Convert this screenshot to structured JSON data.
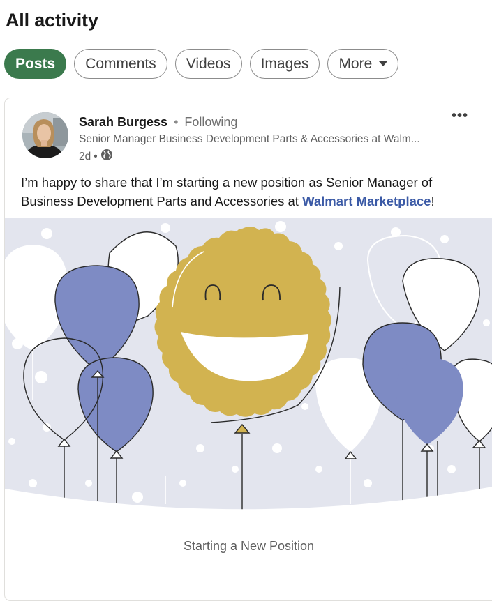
{
  "page": {
    "title": "All activity"
  },
  "filters": [
    {
      "label": "Posts",
      "active": true
    },
    {
      "label": "Comments",
      "active": false
    },
    {
      "label": "Videos",
      "active": false
    },
    {
      "label": "Images",
      "active": false
    },
    {
      "label": "More",
      "active": false
    }
  ],
  "post": {
    "author": "Sarah Burgess",
    "separator": "•",
    "follow_status": "Following",
    "headline": "Senior Manager Business Development Parts & Accessories at Walm...",
    "time": "2d",
    "meta_separator": "•",
    "visibility_icon": "globe-icon",
    "menu_icon": "more-options-icon",
    "menu_glyph": "•••",
    "text_before": "I’m happy to share that I’m starting a new position as Senior Manager of Business Development Parts and Accessories at ",
    "link_text": "Walmart Marketplace",
    "text_after": "!",
    "caption": "Starting a New Position"
  },
  "colors": {
    "active_pill": "#3b7a4d",
    "balloon_purple": "#7e8bc4",
    "sun_gold": "#d2b350",
    "background_grey": "#e3e5ee",
    "link": "#3b5aa6"
  }
}
